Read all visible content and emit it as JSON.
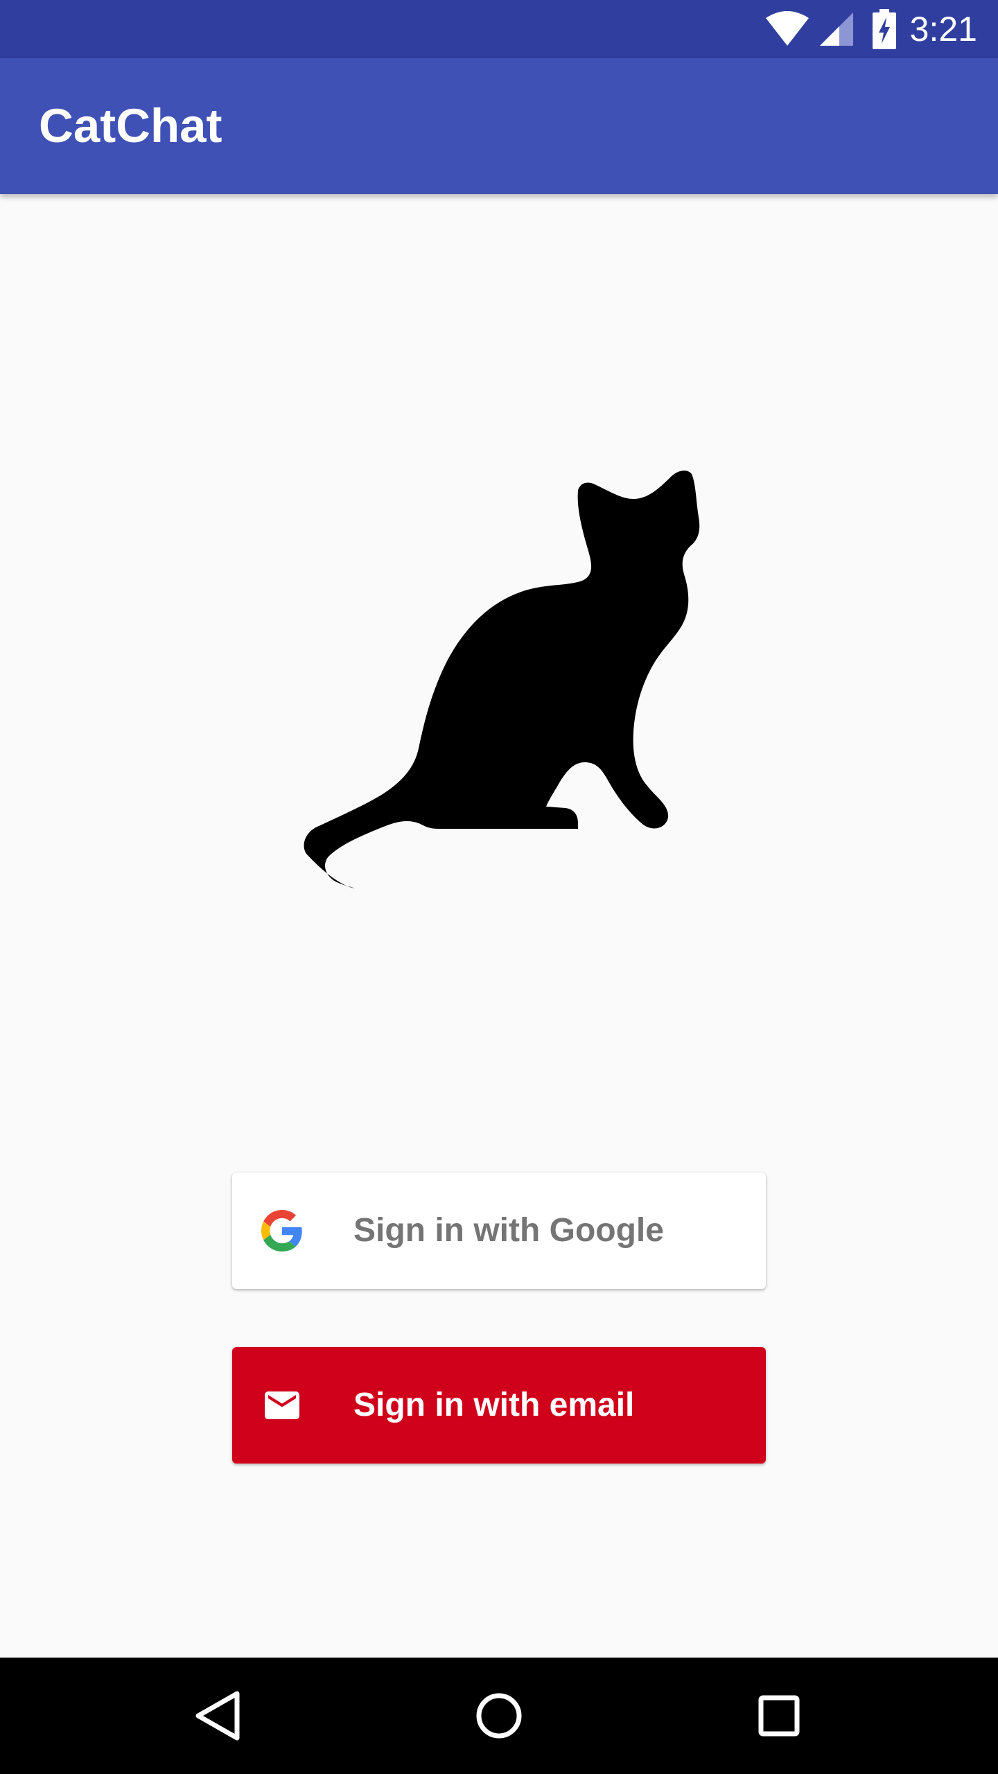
{
  "status_bar": {
    "time": "3:21",
    "icons": [
      "wifi-icon",
      "cell-signal-icon",
      "battery-charging-icon"
    ],
    "background": "#303f9f"
  },
  "app_bar": {
    "title": "CatChat",
    "background": "#3f51b5"
  },
  "logo": {
    "icon": "cat-silhouette-icon"
  },
  "sign_in": {
    "google_label": "Sign in with Google",
    "google_icon": "google-g-icon",
    "email_label": "Sign in with email",
    "email_icon": "mail-icon",
    "email_color": "#d0021b"
  },
  "nav_bar": {
    "icons": [
      "back-icon",
      "home-icon",
      "recents-icon"
    ]
  }
}
